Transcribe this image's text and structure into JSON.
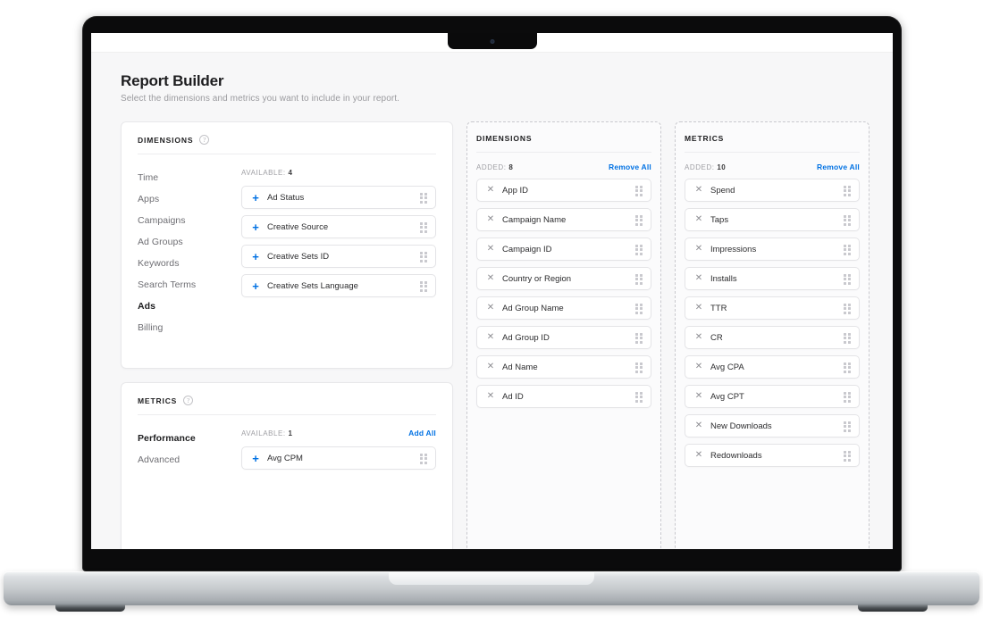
{
  "page": {
    "title": "Report Builder",
    "subtitle": "Select the dimensions and metrics you want to include in your report."
  },
  "icons": {
    "help": "?",
    "plus": "+",
    "remove": "✕",
    "drag_handle": "drag-handle-icon"
  },
  "colors": {
    "accent": "#0071e3",
    "page_bg": "#f7f7f8",
    "card_bg": "#ffffff",
    "border": "#e8e8ea",
    "dashed_border": "#c9c9ce",
    "text_primary": "#1d1d1f",
    "text_secondary": "#6e6e73",
    "text_muted": "#a0a0a5"
  },
  "dimensions_card": {
    "title": "DIMENSIONS",
    "help_tooltip": "?",
    "categories": [
      {
        "label": "Time",
        "active": false
      },
      {
        "label": "Apps",
        "active": false
      },
      {
        "label": "Campaigns",
        "active": false
      },
      {
        "label": "Ad Groups",
        "active": false
      },
      {
        "label": "Keywords",
        "active": false
      },
      {
        "label": "Search Terms",
        "active": false
      },
      {
        "label": "Ads",
        "active": true
      },
      {
        "label": "Billing",
        "active": false
      }
    ],
    "available_label": "AVAILABLE:",
    "available_count": "4",
    "add_all_label": "",
    "available_items": [
      "Ad Status",
      "Creative Source",
      "Creative Sets ID",
      "Creative Sets Language"
    ]
  },
  "metrics_card": {
    "title": "METRICS",
    "help_tooltip": "?",
    "categories": [
      {
        "label": "Performance",
        "active": true
      },
      {
        "label": "Advanced",
        "active": false
      }
    ],
    "available_label": "AVAILABLE:",
    "available_count": "1",
    "add_all_label": "Add All",
    "available_items": [
      "Avg CPM"
    ]
  },
  "added_dimensions": {
    "title": "DIMENSIONS",
    "added_label": "ADDED:",
    "added_count": "8",
    "remove_all_label": "Remove All",
    "items": [
      "App ID",
      "Campaign Name",
      "Campaign ID",
      "Country or Region",
      "Ad Group Name",
      "Ad Group ID",
      "Ad Name",
      "Ad ID"
    ]
  },
  "added_metrics": {
    "title": "METRICS",
    "added_label": "ADDED:",
    "added_count": "10",
    "remove_all_label": "Remove All",
    "items": [
      "Spend",
      "Taps",
      "Impressions",
      "Installs",
      "TTR",
      "CR",
      "Avg CPA",
      "Avg CPT",
      "New Downloads",
      "Redownloads"
    ]
  }
}
